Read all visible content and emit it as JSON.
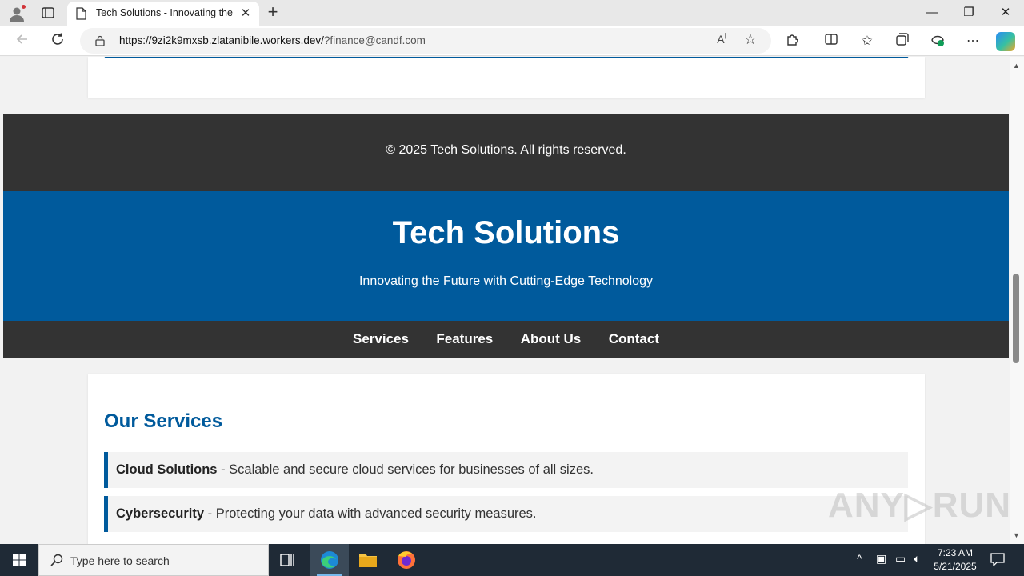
{
  "browser": {
    "tab_title": "Tech Solutions - Innovating the Future",
    "tab_close": "✕",
    "new_tab": "+",
    "url_host": "https://9zi2k9mxsb.zlatanibile.workers.dev/",
    "url_query": "?finance@candf.com",
    "window_controls": {
      "minimize": "—",
      "restore": "❐",
      "close": "✕"
    }
  },
  "page": {
    "footer_text": "© 2025 Tech Solutions. All rights reserved.",
    "header_title": "Tech Solutions",
    "header_tagline": "Innovating the Future with Cutting-Edge Technology",
    "nav": [
      "Services",
      "Features",
      "About Us",
      "Contact"
    ],
    "services_heading": "Our Services",
    "services": [
      {
        "name": "Cloud Solutions",
        "desc": " - Scalable and secure cloud services for businesses of all sizes."
      },
      {
        "name": "Cybersecurity",
        "desc": " - Protecting your data with advanced security measures."
      }
    ],
    "watermark": "ANY▷RUN"
  },
  "taskbar": {
    "search_placeholder": "Type here to search",
    "time": "7:23 AM",
    "date": "5/21/2025"
  },
  "colors": {
    "brand_blue": "#005a9c",
    "dark_band": "#333333"
  },
  "icons": [
    "profile-icon",
    "tabs-icon",
    "page-icon",
    "back-icon",
    "refresh-icon",
    "lock-icon",
    "read-aloud-icon",
    "favorite-star-icon",
    "extensions-icon",
    "split-screen-icon",
    "favorites-icon",
    "collections-icon",
    "performance-icon",
    "more-icon",
    "copilot-icon",
    "windows-start-icon",
    "search-icon",
    "task-view-icon",
    "edge-icon",
    "file-explorer-icon",
    "firefox-icon"
  ]
}
